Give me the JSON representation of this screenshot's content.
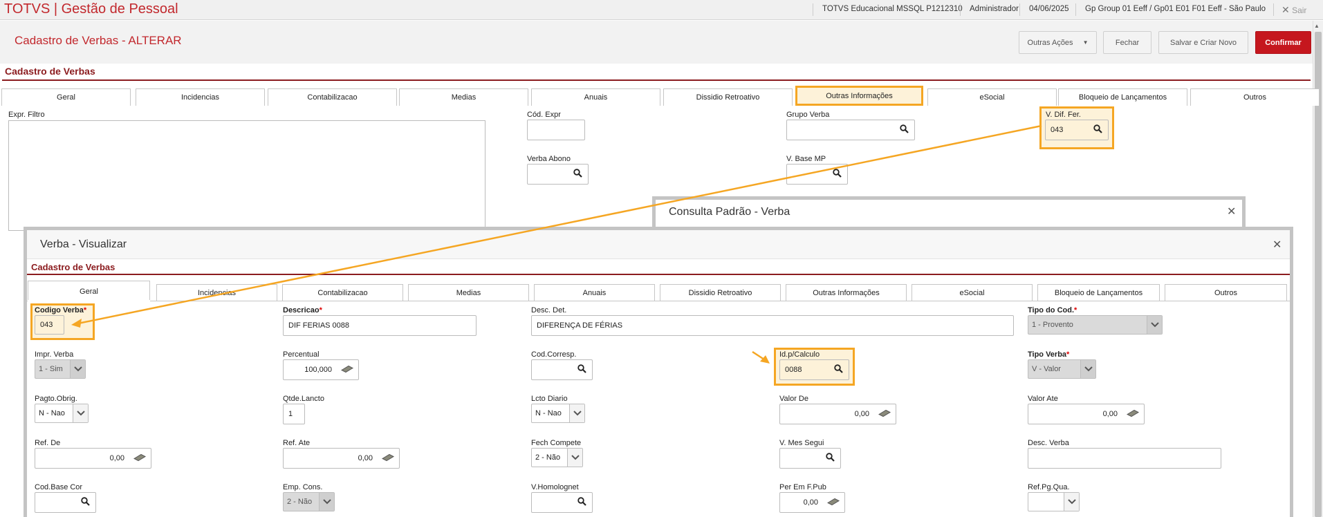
{
  "topbar": {
    "app_title": "TOTVS | Gestão de Pessoal",
    "environment": "TOTVS Educacional MSSQL P1212310",
    "user": "Administrador",
    "date": "04/06/2025",
    "company": "Gp Group 01 Eeff / Gp01 E01 F01 Eeff - São Paulo",
    "exit_label": "Sair"
  },
  "page": {
    "title": "Cadastro de Verbas - ALTERAR",
    "section_title": "Cadastro de Verbas",
    "buttons": {
      "other_actions": "Outras Ações",
      "close": "Fechar",
      "save_new": "Salvar e Criar Novo",
      "confirm": "Confirmar"
    },
    "tabs": [
      "Geral",
      "Incidencias",
      "Contabilizacao",
      "Medias",
      "Anuais",
      "Dissidio Retroativo",
      "Outras Informações",
      "eSocial",
      "Bloqueio de Lançamentos",
      "Outros"
    ],
    "active_tab": "Outras Informações",
    "fields": {
      "expr_filtro_label": "Expr. Filtro",
      "cod_expr_label": "Cód. Expr",
      "grupo_verba_label": "Grupo Verba",
      "v_dif_fer_label": "V. Dif. Fer.",
      "v_dif_fer_value": "043",
      "verba_abono_label": "Verba Abono",
      "v_base_mp_label": "V. Base MP"
    }
  },
  "consulta_modal": {
    "title": "Consulta Padrão - Verba"
  },
  "verba_modal": {
    "title": "Verba - Visualizar",
    "section_title": "Cadastro de Verbas",
    "tabs": [
      "Geral",
      "Incidencias",
      "Contabilizacao",
      "Medias",
      "Anuais",
      "Dissidio Retroativo",
      "Outras Informações",
      "eSocial",
      "Bloqueio de Lançamentos",
      "Outros"
    ],
    "active_tab": "Geral",
    "required_mark": "*",
    "fields": {
      "codigo_verba": {
        "label": "Codigo Verba",
        "value": "043"
      },
      "descricao": {
        "label": "Descricao",
        "value": "DIF FERIAS 0088"
      },
      "desc_det": {
        "label": "Desc. Det.",
        "value": "DIFERENÇA DE FÉRIAS"
      },
      "tipo_do_cod": {
        "label": "Tipo do Cod.",
        "value": "1 - Provento"
      },
      "impr_verba": {
        "label": "Impr. Verba",
        "value": "1 - Sim"
      },
      "percentual": {
        "label": "Percentual",
        "value": "100,000"
      },
      "cod_corresp": {
        "label": "Cod.Corresp.",
        "value": ""
      },
      "id_p_calculo": {
        "label": "Id.p/Calculo",
        "value": "0088"
      },
      "tipo_verba": {
        "label": "Tipo Verba",
        "value": "V - Valor"
      },
      "pagto_obrig": {
        "label": "Pagto.Obrig.",
        "value": "N - Nao"
      },
      "qtde_lancto": {
        "label": "Qtde.Lancto",
        "value": "1"
      },
      "lcto_diario": {
        "label": "Lcto Diario",
        "value": "N - Nao"
      },
      "valor_de": {
        "label": "Valor De",
        "value": "0,00"
      },
      "valor_ate": {
        "label": "Valor Ate",
        "value": "0,00"
      },
      "ref_de": {
        "label": "Ref. De",
        "value": "0,00"
      },
      "ref_ate": {
        "label": "Ref. Ate",
        "value": "0,00"
      },
      "fech_compete": {
        "label": "Fech Compete",
        "value": "2 - Não"
      },
      "v_mes_segui": {
        "label": "V. Mes Segui",
        "value": ""
      },
      "desc_verba": {
        "label": "Desc. Verba",
        "value": ""
      },
      "cod_base_cor": {
        "label": "Cod.Base Cor",
        "value": ""
      },
      "emp_cons": {
        "label": "Emp. Cons.",
        "value": "2 - Não"
      },
      "v_homolognet": {
        "label": "V.Homolognet",
        "value": ""
      },
      "per_em_f_pub": {
        "label": "Per Em F.Pub",
        "value": "0,00"
      },
      "ref_pg_qua": {
        "label": "Ref.Pg.Qua.",
        "value": ""
      }
    }
  },
  "colors": {
    "brand": "#c2282d",
    "highlight": "#f5a623",
    "confirm": "#c5171e"
  }
}
